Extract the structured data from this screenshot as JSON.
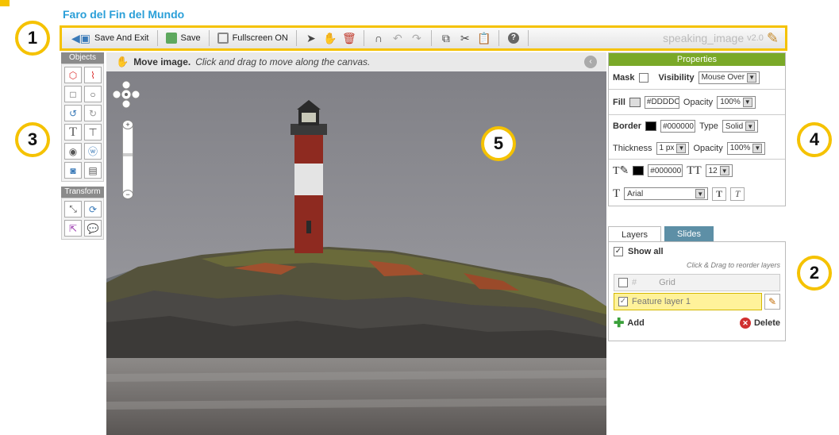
{
  "document_title": "Faro del Fin del Mundo",
  "toolbar": {
    "save_exit": "Save And Exit",
    "save": "Save",
    "fullscreen": "Fullscreen ON",
    "brand": "speaking_image",
    "version": "v2.0"
  },
  "callouts": {
    "one": "1",
    "two": "2",
    "three": "3",
    "four": "4",
    "five": "5"
  },
  "objects_panel": {
    "title": "Objects"
  },
  "transform_panel": {
    "title": "Transform"
  },
  "canvas": {
    "hint_bold": "Move image.",
    "hint_text": "Click and drag to move along the canvas."
  },
  "properties": {
    "title": "Properties",
    "mask_label": "Mask",
    "visibility_label": "Visibility",
    "visibility_value": "Mouse Over",
    "fill_label": "Fill",
    "fill_color": "#DDDDC",
    "opacity_label": "Opacity",
    "fill_opacity": "100%",
    "border_label": "Border",
    "border_color": "#000000",
    "type_label": "Type",
    "type_value": "Solid",
    "thickness_label": "Thickness",
    "thickness_value": "1 px",
    "border_opacity": "100%",
    "text_color": "#000000",
    "font_size": "12",
    "font_family": "Arial"
  },
  "tabs": {
    "layers": "Layers",
    "slides": "Slides"
  },
  "layers": {
    "show_all": "Show all",
    "hint": "Click & Drag to reorder layers",
    "items": [
      {
        "label": "Grid"
      },
      {
        "label": "Feature layer 1"
      }
    ],
    "add": "Add",
    "delete": "Delete"
  },
  "colors": {
    "accent": "#f5c200",
    "title": "#2a9fd8",
    "properties_header": "#7aa928",
    "tab_inactive": "#5d8fa6"
  }
}
